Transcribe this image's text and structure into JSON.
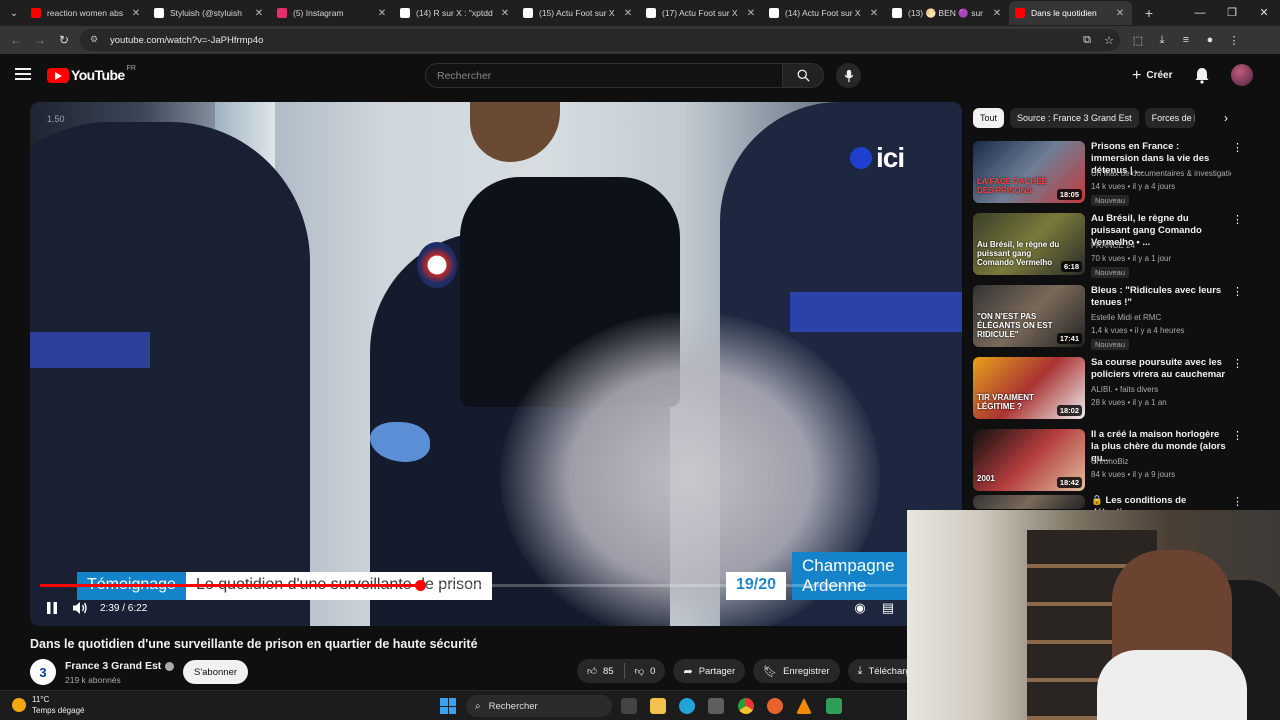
{
  "browser": {
    "tabs": [
      {
        "title": "reaction women abs",
        "icon": "youtube",
        "color": "#ff0000"
      },
      {
        "title": "Styluish (@styluish",
        "icon": "tiktok",
        "color": "#ffffff"
      },
      {
        "title": "(5) Instagram",
        "icon": "instagram",
        "color": "#e1306c"
      },
      {
        "title": "(14) R sur X : \"xptdd",
        "icon": "x",
        "color": "#ffffff"
      },
      {
        "title": "(15) Actu Foot sur X",
        "icon": "x",
        "color": "#ffffff"
      },
      {
        "title": "(17) Actu Foot sur X",
        "icon": "x",
        "color": "#ffffff"
      },
      {
        "title": "(14) Actu Foot sur X",
        "icon": "x",
        "color": "#ffffff"
      },
      {
        "title": "(13) 🌕 BEN 🟣 sur",
        "icon": "x",
        "color": "#ffffff"
      },
      {
        "title": "Dans le quotidien",
        "icon": "youtube",
        "color": "#ff0000",
        "active": true
      }
    ],
    "url": "youtube.com/watch?v=-JaPHfrmp4o"
  },
  "youtube": {
    "logo_text": "YouTube",
    "country_code": "FR",
    "search_placeholder": "Rechercher",
    "create_label": "Créer"
  },
  "player": {
    "speed": "1.50",
    "broadcaster_logo": "ici",
    "lower_third_tag": "Témoignage",
    "lower_third_text": "Le quotidien d'une surveillante de prison",
    "news_time": "19/20",
    "region_line1": "Champagne",
    "region_line2": "Ardenne",
    "time_display": "2:39 / 6:22",
    "progress_fraction": 0.418
  },
  "video": {
    "title": "Dans le quotidien d'une surveillante de prison en quartier de haute sécurité",
    "channel_initial": "3",
    "channel_name": "France 3 Grand Est",
    "subscribers": "219 k abonnés",
    "subscribe_label": "S'abonner",
    "likes": "85",
    "dislikes": "0",
    "share_label": "Partager",
    "save_label": "Enregistrer",
    "download_label": "Télécharger"
  },
  "sidebar": {
    "chips": [
      "Tout",
      "Source : France 3 Grand Est",
      "Forces de l"
    ],
    "recommendations": [
      {
        "title": "Prisons en France : immersion dans la vie des détenus | ...",
        "channel": "Un Max de documentaires & investigatio...",
        "meta": "14 k vues • il y a 4 jours",
        "badge": "Nouveau",
        "duration": "18:05",
        "thumb_caption": "LA FACE CACHÉE DES PRISONS"
      },
      {
        "title": "Au Brésil, le règne du puissant gang Comando Vermelho • ...",
        "channel": "FRANCE 24",
        "meta": "70 k vues • il y a 1 jour",
        "badge": "Nouveau",
        "duration": "6:18",
        "thumb_caption": "Au Brésil, le règne du puissant gang Comando Vermelho"
      },
      {
        "title": "Bleus : \"Ridicules avec leurs tenues !\"",
        "channel": "Estelle Midi et RMC",
        "meta": "1,4 k vues • il y a 4 heures",
        "badge": "Nouveau",
        "duration": "17:41",
        "thumb_caption": "\"ON N'EST PAS ÉLÉGANTS ON EST RIDICULE\""
      },
      {
        "title": "Sa course poursuite avec les policiers virera au cauchemar",
        "channel": "ALIBI. • faits divers",
        "meta": "28 k vues • il y a 1 an",
        "badge": "",
        "duration": "18:02",
        "thumb_caption": "TIR VRAIMENT LÉGITIME ?"
      },
      {
        "title": "Il a créé la maison horlogère la plus chère du monde (alors qu...",
        "channel": "ChronoBiz",
        "meta": "84 k vues • il y a 9 jours",
        "badge": "",
        "duration": "18:42",
        "thumb_caption": "2001"
      },
      {
        "title": "🔒 Les conditions de détention",
        "channel": "",
        "meta": "",
        "badge": "",
        "duration": "",
        "thumb_caption": ""
      }
    ]
  },
  "taskbar": {
    "temperature": "11°C",
    "weather": "Temps dégagé",
    "search_label": "Rechercher"
  }
}
